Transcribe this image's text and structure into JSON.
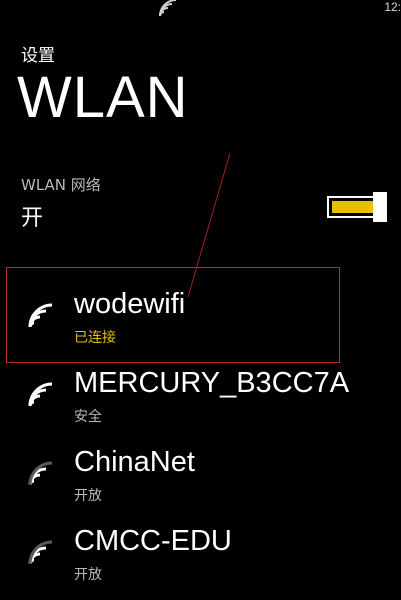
{
  "status_bar": {
    "time": "12:",
    "wifi_icon": "wifi-icon"
  },
  "header": {
    "section": "设置",
    "title": "WLAN"
  },
  "wlan_toggle": {
    "label": "WLAN 网络",
    "state": "开",
    "on": true,
    "accent_color": "#e5c000"
  },
  "annotation": {
    "box_color": "#c02a2a"
  },
  "networks": [
    {
      "name": "wodewifi",
      "status": "已连接",
      "connected": true,
      "signal": "full"
    },
    {
      "name": "MERCURY_B3CC7A",
      "status": "安全",
      "connected": false,
      "signal": "full"
    },
    {
      "name": "ChinaNet",
      "status": "开放",
      "connected": false,
      "signal": "medium"
    },
    {
      "name": "CMCC-EDU",
      "status": "开放",
      "connected": false,
      "signal": "medium"
    }
  ]
}
